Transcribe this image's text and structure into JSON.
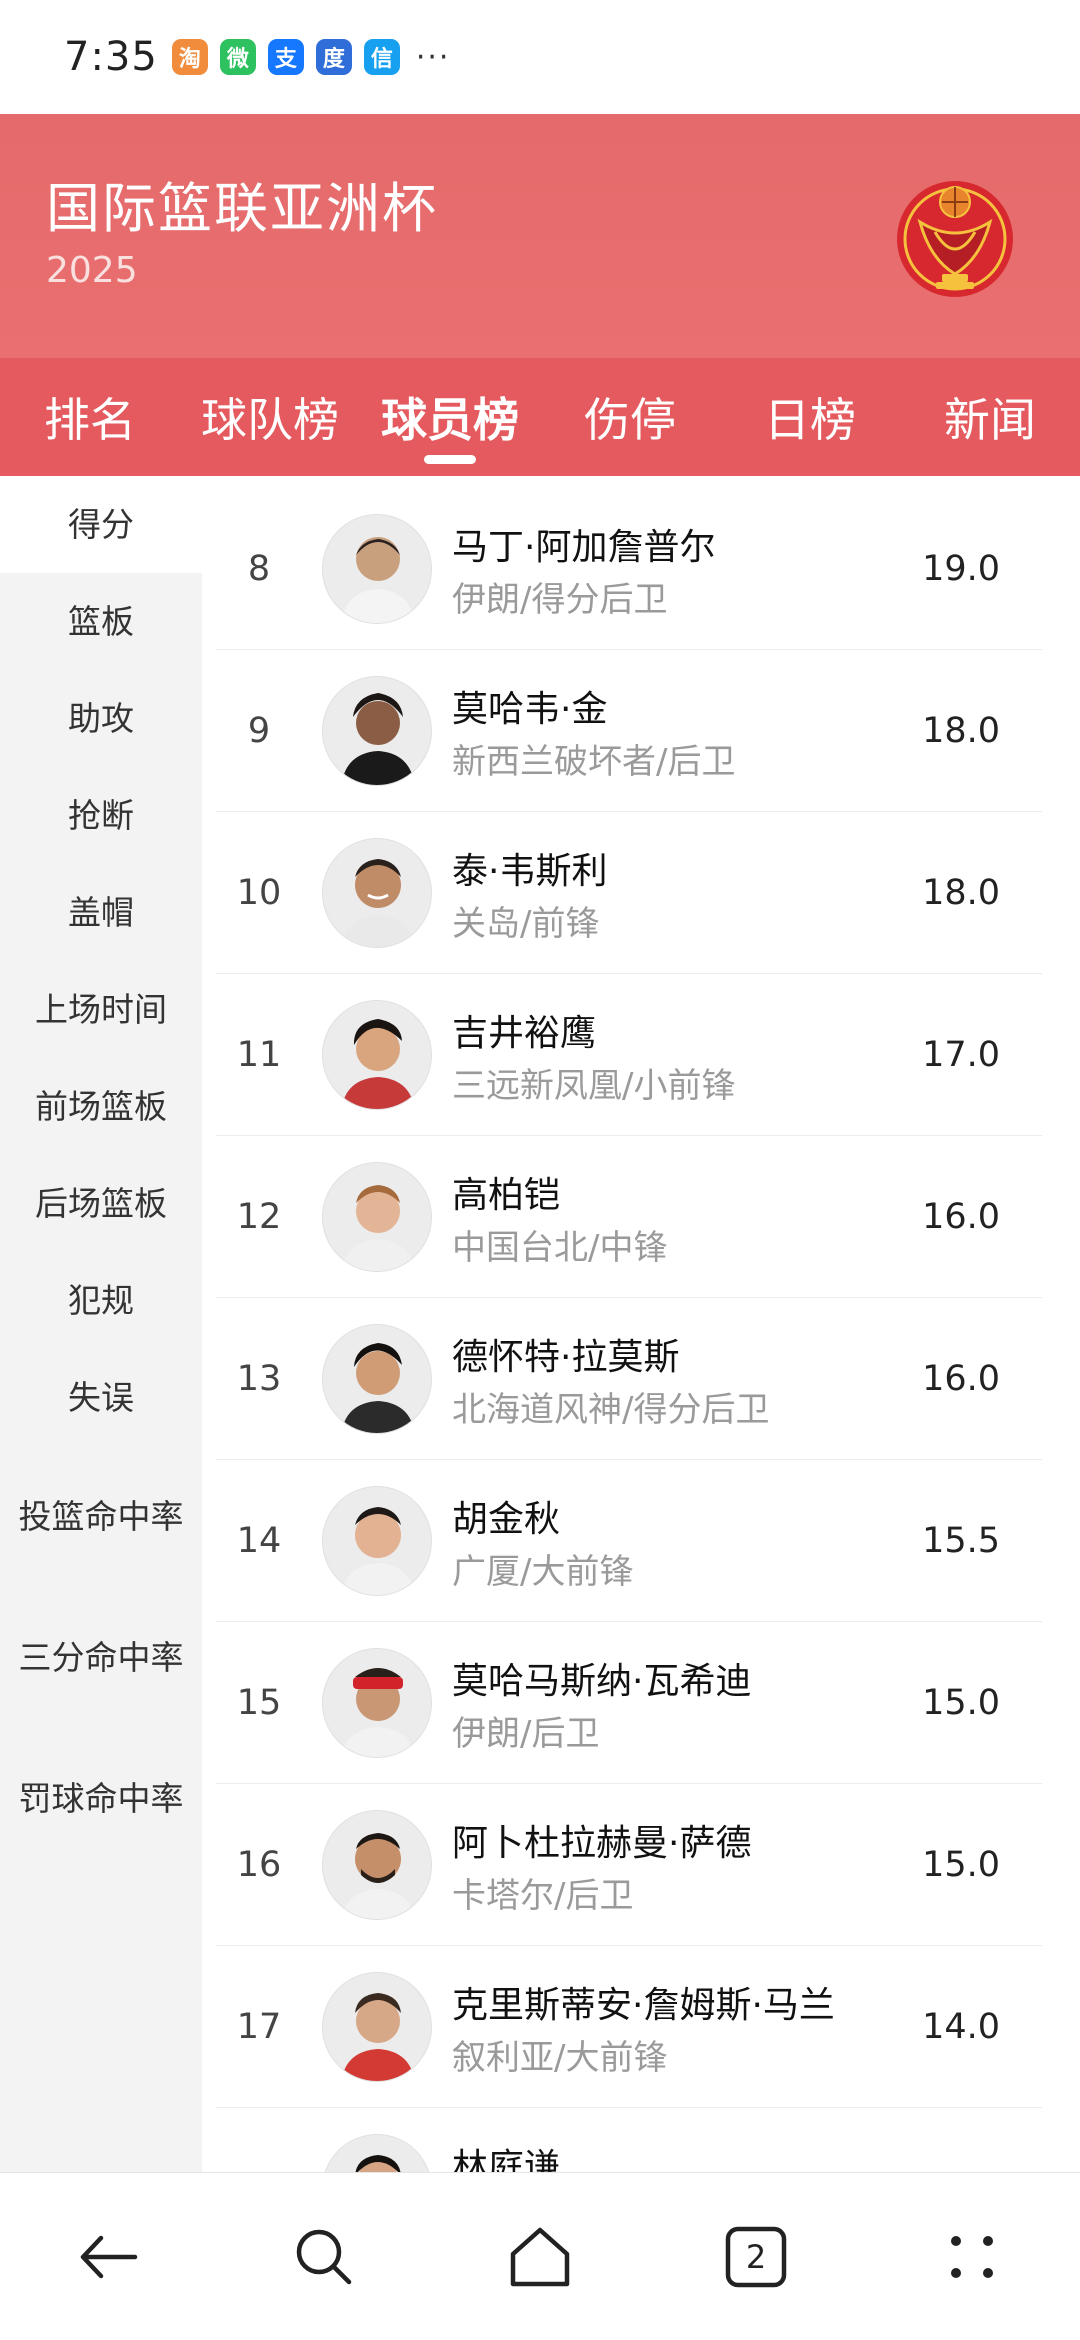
{
  "status_bar": {
    "time": "7:35",
    "app_icons": [
      {
        "name": "taobao-icon",
        "color": "#f08c3c",
        "glyph": "淘"
      },
      {
        "name": "wechat-icon",
        "color": "#2dc160",
        "glyph": "微"
      },
      {
        "name": "alipay-icon",
        "color": "#1677ff",
        "glyph": "支"
      },
      {
        "name": "baidu-icon",
        "color": "#2f6ed8",
        "glyph": "度"
      },
      {
        "name": "message-icon",
        "color": "#18a0f0",
        "glyph": "信"
      }
    ],
    "more": "···"
  },
  "header": {
    "title": "国际篮联亚洲杯",
    "year": "2025",
    "logo_icon": "fiba-asia-cup-logo"
  },
  "tabs": [
    {
      "label": "排名",
      "active": false
    },
    {
      "label": "球队榜",
      "active": false
    },
    {
      "label": "球员榜",
      "active": true
    },
    {
      "label": "伤停",
      "active": false
    },
    {
      "label": "日榜",
      "active": false
    },
    {
      "label": "新闻",
      "active": false
    }
  ],
  "categories": [
    {
      "label": "得分",
      "active": true
    },
    {
      "label": "篮板",
      "active": false
    },
    {
      "label": "助攻",
      "active": false
    },
    {
      "label": "抢断",
      "active": false
    },
    {
      "label": "盖帽",
      "active": false
    },
    {
      "label": "上场时间",
      "active": false
    },
    {
      "label": "前场篮板",
      "active": false
    },
    {
      "label": "后场篮板",
      "active": false
    },
    {
      "label": "犯规",
      "active": false
    },
    {
      "label": "失误",
      "active": false
    },
    {
      "label": "投篮命中率",
      "active": false
    },
    {
      "label": "三分命中率",
      "active": false
    },
    {
      "label": "罚球命中率",
      "active": false
    }
  ],
  "players": [
    {
      "rank": "8",
      "name": "马丁·阿加詹普尔",
      "team_position": "伊朗/得分后卫",
      "value": "19.0"
    },
    {
      "rank": "9",
      "name": "莫哈韦·金",
      "team_position": "新西兰破坏者/后卫",
      "value": "18.0"
    },
    {
      "rank": "10",
      "name": "泰·韦斯利",
      "team_position": "关岛/前锋",
      "value": "18.0"
    },
    {
      "rank": "11",
      "name": "吉井裕鹰",
      "team_position": "三远新凤凰/小前锋",
      "value": "17.0"
    },
    {
      "rank": "12",
      "name": "高柏铠",
      "team_position": "中国台北/中锋",
      "value": "16.0"
    },
    {
      "rank": "13",
      "name": "德怀特·拉莫斯",
      "team_position": "北海道风神/得分后卫",
      "value": "16.0"
    },
    {
      "rank": "14",
      "name": "胡金秋",
      "team_position": "广厦/大前锋",
      "value": "15.5"
    },
    {
      "rank": "15",
      "name": "莫哈马斯纳·瓦希迪",
      "team_position": "伊朗/后卫",
      "value": "15.0"
    },
    {
      "rank": "16",
      "name": "阿卜杜拉赫曼·萨德",
      "team_position": "卡塔尔/后卫",
      "value": "15.0"
    },
    {
      "rank": "17",
      "name": "克里斯蒂安·詹姆斯·马兰",
      "team_position": "叙利亚/大前锋",
      "value": "14.0"
    },
    {
      "rank": "",
      "name": "林庭谦",
      "team_position": "",
      "value": ""
    }
  ],
  "bottom_nav": {
    "tab_count": "2"
  },
  "colors": {
    "header": "#e96f70",
    "tab_bar": "#e45a5e",
    "sidebar": "#f3f3f3"
  }
}
